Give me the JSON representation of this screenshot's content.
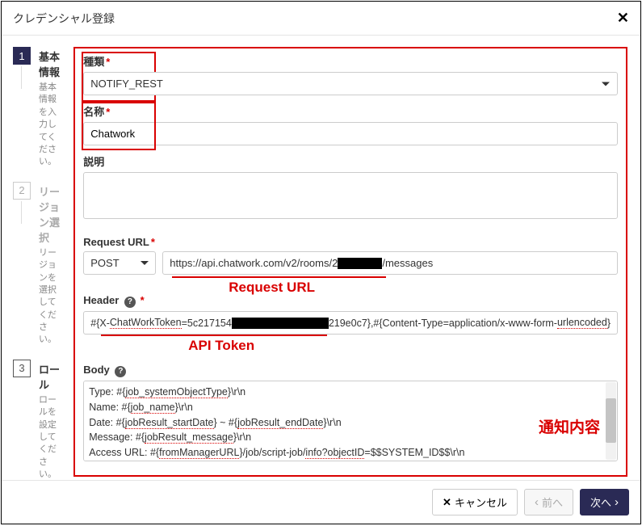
{
  "dialog": {
    "title": "クレデンシャル登録"
  },
  "steps": [
    {
      "num": "1",
      "title": "基本情報",
      "desc": "基本情報を入力してください。"
    },
    {
      "num": "2",
      "title": "リージョン選択",
      "desc": "リージョンを選択してください。"
    },
    {
      "num": "3",
      "title": "ロール",
      "desc": "ロールを設定してください。"
    }
  ],
  "form": {
    "type_label": "種類",
    "type_value": "NOTIFY_REST",
    "name_label": "名称",
    "name_value": "Chatwork",
    "desc_label": "説明",
    "desc_value": "",
    "request_url_label": "Request URL",
    "method_value": "POST",
    "url_prefix": "https://api.chatwork.com/v2/rooms/2",
    "url_suffix": "/messages",
    "header_label": "Header",
    "header_prefix": "#{X-",
    "header_token_key": "ChatWorkToken",
    "header_eq": "=5c217154",
    "header_tail": "219e0c7},#{Content-Type=application/x-www-form-",
    "header_enc": "urlencoded",
    "header_close": "}",
    "body_label": "Body",
    "body_lines": [
      "    Type: #{job_systemObjectType}\\r\\n",
      "    Name: #{job_name}\\r\\n",
      "    Date: #{jobResult_startDate} ~ #{jobResult_endDate}\\r\\n",
      "    Message: #{jobResult_message}\\r\\n",
      "    Access URL: #{fromManagerURL}/job/script-job/info?objectID=$$SYSTEM_ID$$\\r\\n"
    ],
    "body_wavy_tokens": [
      "job_systemObjectType",
      "job_name",
      "jobResult_startDate",
      "jobResult_endDate",
      "jobResult_message",
      "fromManagerURL",
      "info?objectID"
    ]
  },
  "annotations": {
    "request_url": "Request URL",
    "api_token": "API Token",
    "notify_content": "通知内容"
  },
  "footer": {
    "cancel": "キャンセル",
    "prev": "前へ",
    "next": "次へ"
  }
}
